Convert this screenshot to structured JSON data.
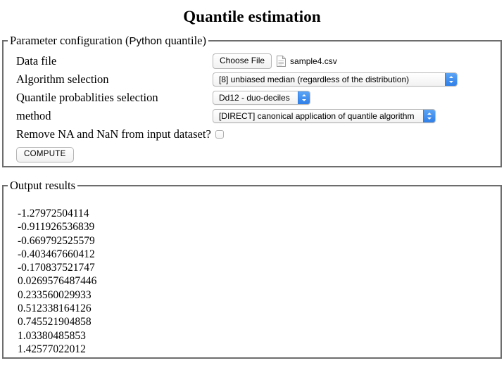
{
  "page": {
    "title": "Quantile estimation"
  },
  "parameter_section": {
    "legend_prefix": "Parameter configuration (",
    "legend_mono": "Python",
    "legend_suffix": " quantile)",
    "rows": {
      "data_file": {
        "label": "Data file",
        "choose_button": "Choose File",
        "file_icon": "document-icon",
        "file_name": "sample4.csv"
      },
      "algorithm": {
        "label": "Algorithm selection",
        "value": "[8] unbiased median (regardless of the distribution)"
      },
      "quantile_probabilities": {
        "label": "Quantile probablities selection",
        "value": "Dd12 - duo-deciles"
      },
      "method": {
        "label": "method",
        "value": "[DIRECT] canonical application of quantile algorithm"
      },
      "remove_na": {
        "label": "Remove NA and NaN from input dataset?",
        "checked": false
      }
    },
    "compute_button": "COMPUTE"
  },
  "output_section": {
    "legend": "Output results",
    "results": [
      "-1.27972504114",
      "-0.911926536839",
      "-0.669792525579",
      "-0.403467660412",
      "-0.170837521747",
      "0.0269576487446",
      "0.233560029933",
      "0.512338164126",
      "0.745521904858",
      "1.03380485853",
      "1.42577022012"
    ]
  },
  "colors": {
    "select_arrow_blue": "#3b8ef0",
    "fieldset_border": "#6d6d6d",
    "text": "#000000",
    "background": "#ffffff"
  }
}
